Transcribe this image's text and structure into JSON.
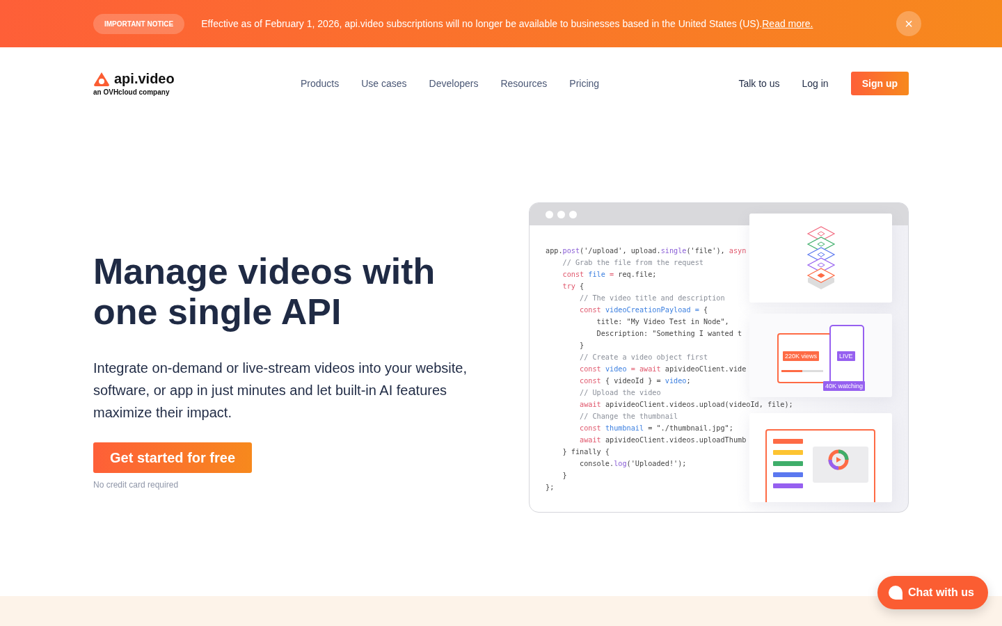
{
  "banner": {
    "badge": "IMPORTANT NOTICE",
    "message": "Effective as of February 1, 2026, api.video subscriptions will no longer be available to businesses based in the United States (US).",
    "link": "Read more.",
    "close": "×"
  },
  "logo": {
    "name": "api.video",
    "tagline": "an OVHcloud company"
  },
  "nav": {
    "items": [
      "Products",
      "Use cases",
      "Developers",
      "Resources",
      "Pricing"
    ],
    "links": [
      "Talk to us",
      "Log in"
    ],
    "signup": "Sign up"
  },
  "hero": {
    "title": "Manage videos with one single API",
    "description": "Integrate on-demand or live-stream videos into your website, software, or app in just minutes and let built-in AI features maximize their impact.",
    "cta": "Get started for free",
    "note": "No credit card required"
  },
  "code": [
    [
      {
        "kind": "plain",
        "text": "app."
      },
      {
        "kind": "fn",
        "text": "post"
      },
      {
        "kind": "plain",
        "text": "('/upload', upload."
      },
      {
        "kind": "fn",
        "text": "single"
      },
      {
        "kind": "plain",
        "text": "('file'), "
      },
      {
        "kind": "keyword",
        "text": "asyn"
      }
    ],
    [
      {
        "kind": "comment",
        "text": "    // Grab the file from the request"
      }
    ],
    [
      {
        "kind": "keyword",
        "text": "    const "
      },
      {
        "kind": "var",
        "text": "file"
      },
      {
        "kind": "keyword",
        "text": " = "
      },
      {
        "kind": "plain",
        "text": "req.file;"
      }
    ],
    [
      {
        "kind": "keyword",
        "text": "    try"
      },
      {
        "kind": "plain",
        "text": " {"
      }
    ],
    [
      {
        "kind": "comment",
        "text": "        // The video title and description"
      }
    ],
    [
      {
        "kind": "keyword",
        "text": "        const "
      },
      {
        "kind": "var",
        "text": "videoCreationPayload = "
      },
      {
        "kind": "plain",
        "text": "{"
      }
    ],
    [
      {
        "kind": "plain",
        "text": "            title: \"My Video Test in Node\","
      }
    ],
    [
      {
        "kind": "plain",
        "text": "            Description: \"Something I wanted t"
      }
    ],
    [
      {
        "kind": "plain",
        "text": "        }"
      }
    ],
    [
      {
        "kind": "comment",
        "text": "        // Create a video object first"
      }
    ],
    [
      {
        "kind": "keyword",
        "text": "        const "
      },
      {
        "kind": "var",
        "text": "video"
      },
      {
        "kind": "keyword",
        "text": " = await "
      },
      {
        "kind": "plain",
        "text": "apivideoClient.vide"
      }
    ],
    [
      {
        "kind": "keyword",
        "text": "        const "
      },
      {
        "kind": "plain",
        "text": "{ videoId } = "
      },
      {
        "kind": "var",
        "text": "video"
      },
      {
        "kind": "plain",
        "text": ";"
      }
    ],
    [
      {
        "kind": "comment",
        "text": "        // Upload the video"
      }
    ],
    [
      {
        "kind": "keyword",
        "text": "        await "
      },
      {
        "kind": "plain",
        "text": "apivideoClient.videos.upload(videoId, file);"
      }
    ],
    [
      {
        "kind": "comment",
        "text": "        // Change the thumbnail"
      }
    ],
    [
      {
        "kind": "keyword",
        "text": "        const "
      },
      {
        "kind": "var",
        "text": "thumbnail"
      },
      {
        "kind": "plain",
        "text": " = \"./thumbnail.jpg\";"
      }
    ],
    [
      {
        "kind": "keyword",
        "text": "        await "
      },
      {
        "kind": "plain",
        "text": "apivideoClient.videos.uploadThumb"
      }
    ],
    [
      {
        "kind": "plain",
        "text": "    } finally {"
      }
    ],
    [
      {
        "kind": "plain",
        "text": "        console."
      },
      {
        "kind": "fn",
        "text": "log"
      },
      {
        "kind": "plain",
        "text": "('Uploaded!');"
      }
    ],
    [
      {
        "kind": "plain",
        "text": "    }"
      }
    ],
    [
      {
        "kind": "plain",
        "text": "};"
      }
    ]
  ],
  "cards": [
    {
      "kind": "layers"
    },
    {
      "kind": "devices",
      "views": "220K views",
      "live": "LIVE",
      "watching": "40K watching",
      "level": 0.5
    },
    {
      "kind": "dashboard"
    }
  ],
  "chat": {
    "label": "Chat with us"
  }
}
